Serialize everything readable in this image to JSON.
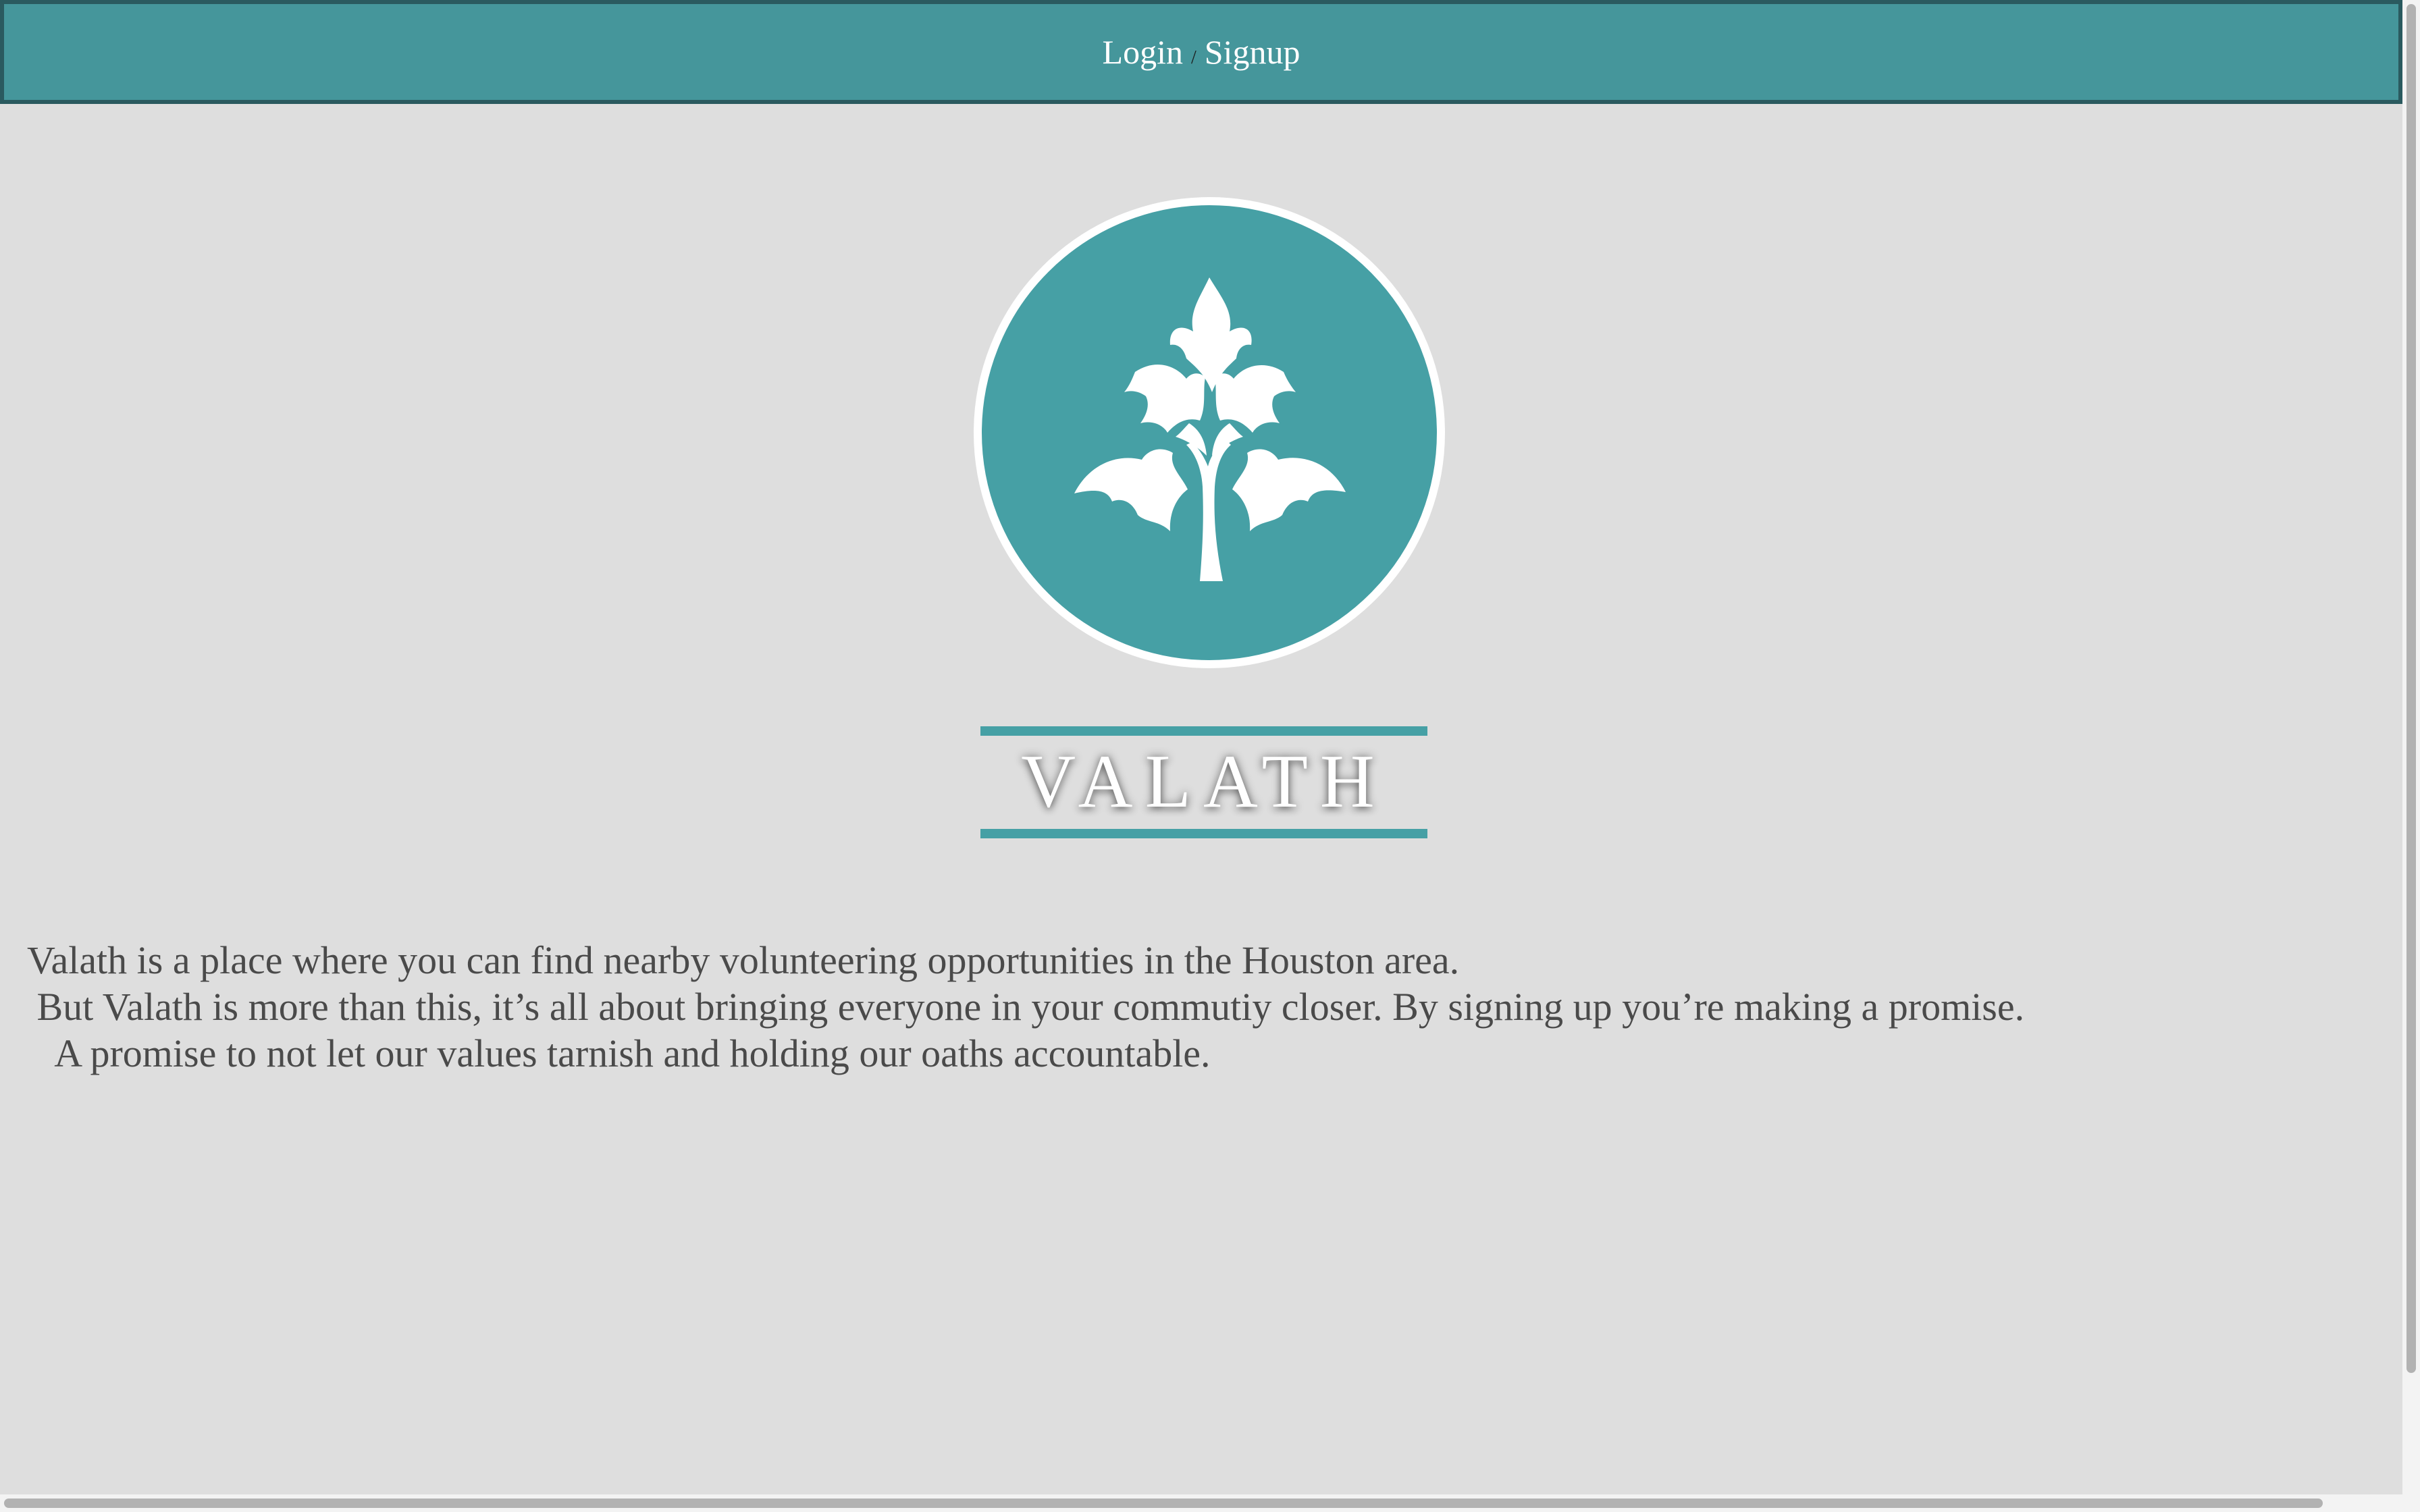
{
  "header": {
    "login_label": "Login",
    "separator": "/",
    "signup_label": "Signup"
  },
  "logo": {
    "icon": "tree-icon",
    "wordmark": "VALATH"
  },
  "description": {
    "lines": [
      "Valath is a place where you can find nearby volunteering opportunities in the Houston area.",
      " But Valath is more than this, it’s all about bringing everyone in your commutiy closer. By signing up you’re making a promise.",
      "   A promise to not let our values tarnish and holding our oaths accountable."
    ]
  },
  "colors": {
    "accent": "#46a0a5",
    "header_border": "#2a5a5f",
    "background": "#dedede",
    "text": "#4a4a4a"
  }
}
